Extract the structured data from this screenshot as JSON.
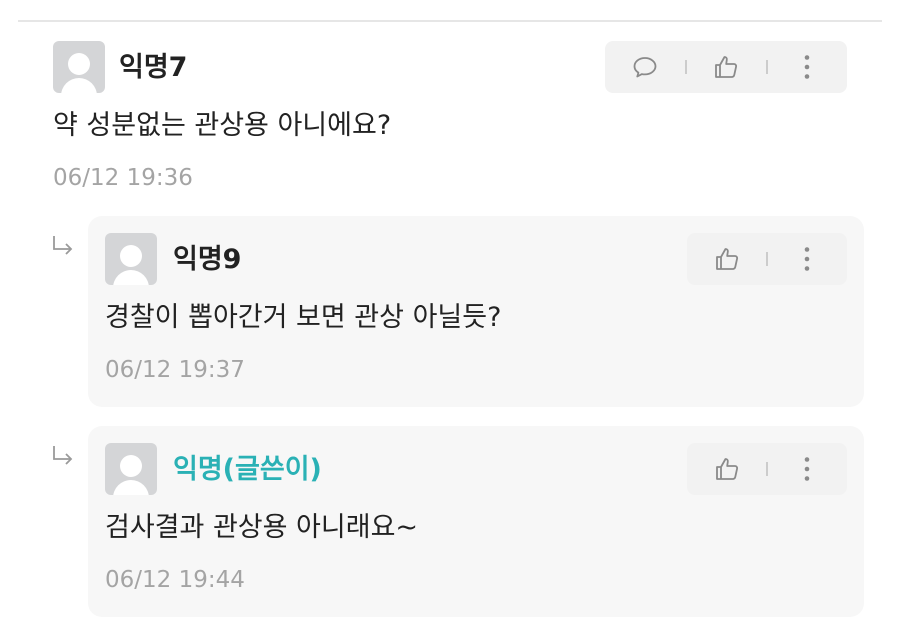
{
  "comments": [
    {
      "author": "익명7",
      "text": "약 성분없는 관상용 아니에요?",
      "time": "06/12 19:36",
      "actions": [
        "comment-icon",
        "like-icon",
        "more-icon"
      ]
    }
  ],
  "replies": [
    {
      "author": "익명9",
      "text": "경찰이 뽑아간거 보면 관상 아닐듯?",
      "time": "06/12 19:37",
      "is_writer": false,
      "actions": [
        "like-icon",
        "more-icon"
      ]
    },
    {
      "author": "익명(글쓴이)",
      "text": "검사결과 관상용 아니래요~",
      "time": "06/12 19:44",
      "is_writer": true,
      "actions": [
        "like-icon",
        "more-icon"
      ]
    }
  ],
  "colors": {
    "writer_accent": "#2ab1b5",
    "timestamp": "#a4a4a4",
    "reply_card_bg": "#f7f7f7",
    "action_bar_bg": "#f2f2f2"
  }
}
